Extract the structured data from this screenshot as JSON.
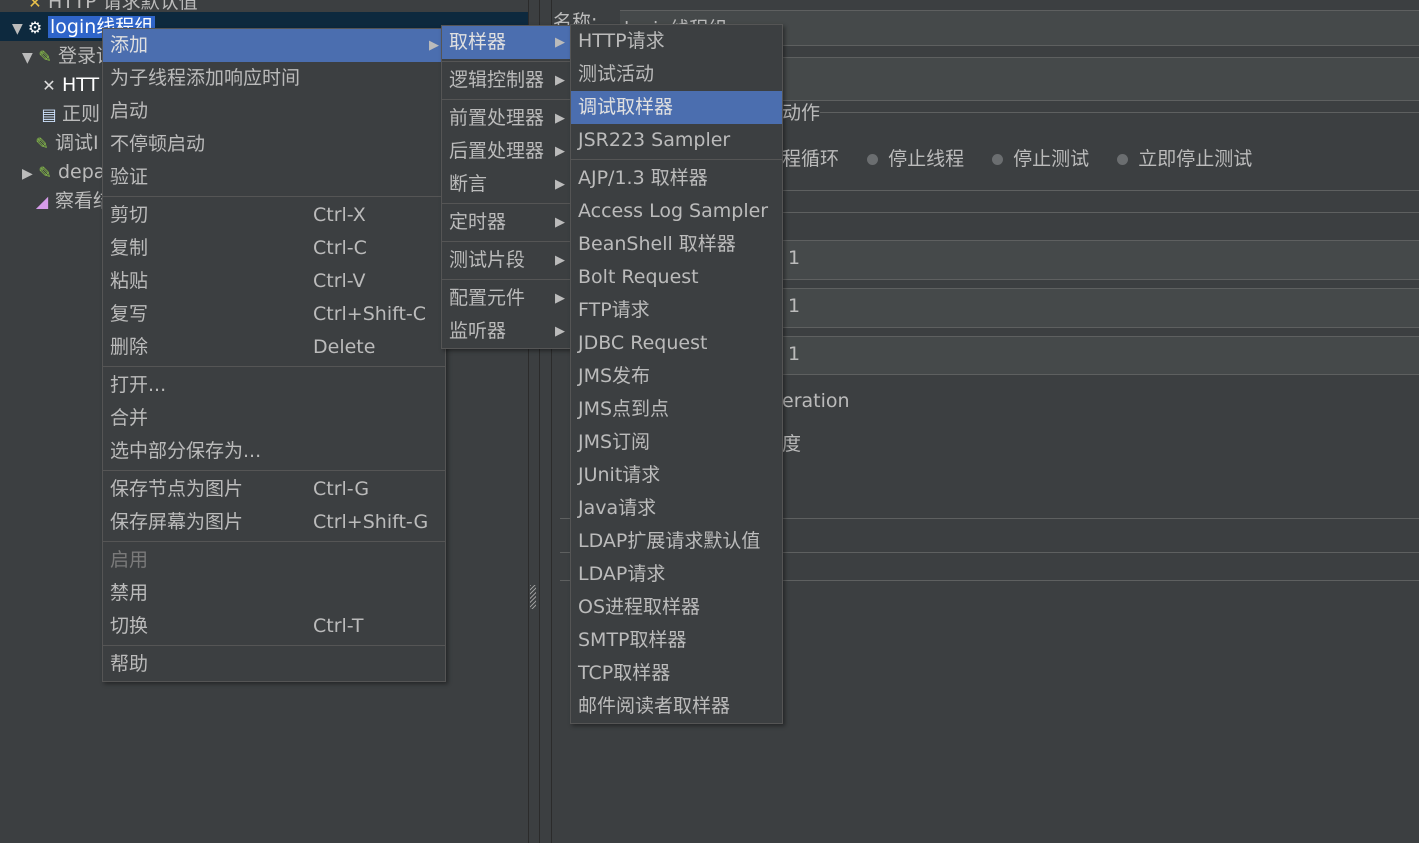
{
  "colors": {
    "background": "#3c3f41",
    "highlight": "#4b6eaf",
    "tree_selection": "#0d293e",
    "text": "#bbbbbb"
  },
  "tree": {
    "items": [
      {
        "label": "HTTP 请求默认值",
        "icon": "wrench-icon"
      },
      {
        "label": "login线程组",
        "icon": "gear-icon",
        "selected": true,
        "expanded": true
      },
      {
        "label": "登录请",
        "icon": "pipette-icon",
        "expanded": true
      },
      {
        "label": "HTT",
        "icon": "wrench-icon"
      },
      {
        "label": "正则",
        "icon": "document-icon"
      },
      {
        "label": "调试I",
        "icon": "pipette-icon"
      },
      {
        "label": "depa",
        "icon": "pipette-icon",
        "expanded": false
      },
      {
        "label": "察看结",
        "icon": "graph-icon"
      }
    ]
  },
  "right_panel": {
    "name_label": "名称:",
    "name_value": "login线程组",
    "action_group_title": "动作",
    "radio_partial": "程循环",
    "radios": [
      "停止线程",
      "停止测试",
      "立即停止测试"
    ],
    "field_values": [
      "1",
      "1",
      "1"
    ],
    "iteration_partial": "eration",
    "partial_char": "度"
  },
  "context_menu": [
    {
      "label": "添加",
      "submenu": true,
      "highlighted": true
    },
    {
      "label": "为子线程添加响应时间"
    },
    {
      "label": "启动"
    },
    {
      "label": "不停顿启动"
    },
    {
      "label": "验证"
    },
    {
      "separator": true
    },
    {
      "label": "剪切",
      "shortcut": "Ctrl-X"
    },
    {
      "label": "复制",
      "shortcut": "Ctrl-C"
    },
    {
      "label": "粘贴",
      "shortcut": "Ctrl-V"
    },
    {
      "label": "复写",
      "shortcut": "Ctrl+Shift-C"
    },
    {
      "label": "删除",
      "shortcut": "Delete"
    },
    {
      "separator": true
    },
    {
      "label": "打开..."
    },
    {
      "label": "合并"
    },
    {
      "label": "选中部分保存为..."
    },
    {
      "separator": true
    },
    {
      "label": "保存节点为图片",
      "shortcut": "Ctrl-G"
    },
    {
      "label": "保存屏幕为图片",
      "shortcut": "Ctrl+Shift-G"
    },
    {
      "separator": true
    },
    {
      "label": "启用",
      "disabled": true
    },
    {
      "label": "禁用"
    },
    {
      "label": "切换",
      "shortcut": "Ctrl-T"
    },
    {
      "separator": true
    },
    {
      "label": "帮助"
    }
  ],
  "add_submenu": [
    {
      "label": "取样器",
      "submenu": true,
      "highlighted": true
    },
    {
      "separator": true
    },
    {
      "label": "逻辑控制器",
      "submenu": true
    },
    {
      "separator": true
    },
    {
      "label": "前置处理器",
      "submenu": true
    },
    {
      "label": "后置处理器",
      "submenu": true
    },
    {
      "label": "断言",
      "submenu": true
    },
    {
      "separator": true
    },
    {
      "label": "定时器",
      "submenu": true
    },
    {
      "separator": true
    },
    {
      "label": "测试片段",
      "submenu": true
    },
    {
      "separator": true
    },
    {
      "label": "配置元件",
      "submenu": true
    },
    {
      "label": "监听器",
      "submenu": true
    }
  ],
  "sampler_submenu": [
    {
      "label": "HTTP请求"
    },
    {
      "label": "测试活动"
    },
    {
      "label": "调试取样器",
      "highlighted": true
    },
    {
      "label": "JSR223 Sampler"
    },
    {
      "separator": true
    },
    {
      "label": "AJP/1.3 取样器"
    },
    {
      "label": "Access Log Sampler"
    },
    {
      "label": "BeanShell 取样器"
    },
    {
      "label": "Bolt Request"
    },
    {
      "label": "FTP请求"
    },
    {
      "label": "JDBC Request"
    },
    {
      "label": "JMS发布"
    },
    {
      "label": "JMS点到点"
    },
    {
      "label": "JMS订阅"
    },
    {
      "label": "JUnit请求"
    },
    {
      "label": "Java请求"
    },
    {
      "label": "LDAP扩展请求默认值"
    },
    {
      "label": "LDAP请求"
    },
    {
      "label": "OS进程取样器"
    },
    {
      "label": "SMTP取样器"
    },
    {
      "label": "TCP取样器"
    },
    {
      "label": "邮件阅读者取样器"
    }
  ]
}
